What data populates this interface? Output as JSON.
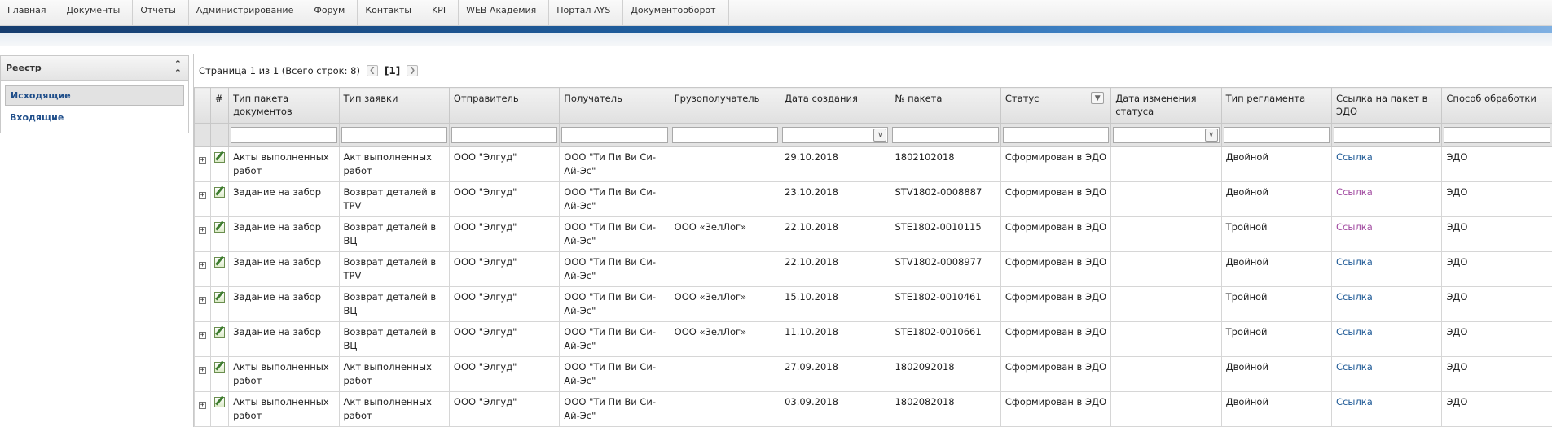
{
  "nav": [
    "Главная",
    "Документы",
    "Отчеты",
    "Администрирование",
    "Форум",
    "Контакты",
    "KPI",
    "WEB Академия",
    "Портал AYS",
    "Документооборот"
  ],
  "sidebar": {
    "title": "Реестр",
    "items": [
      {
        "label": "Исходящие",
        "active": true
      },
      {
        "label": "Входящие",
        "active": false
      }
    ]
  },
  "pager": {
    "text": "Страница 1 из 1 (Всего строк: 8)",
    "current": "[1]",
    "prev_icon": "chevron-left-icon",
    "next_icon": "chevron-right-icon"
  },
  "columns": [
    "#",
    "Тип пакета документов",
    "Тип заявки",
    "Отправитель",
    "Получатель",
    "Грузополучатель",
    "Дата создания",
    "№ пакета",
    "Статус",
    "Дата изменения статуса",
    "Тип регламента",
    "Ссылка на пакет в ЭДО",
    "Способ обработки"
  ],
  "rows": [
    {
      "type": "Акты выполненных работ",
      "request": "Акт выполненных работ",
      "sender": "ООО \"Элгуд\"",
      "recipient": "ООО \"Ти Пи Ви Си-Ай-Эс\"",
      "consignee": "",
      "created": "29.10.2018",
      "num": "1802102018",
      "status": "Сформирован в ЭДО",
      "changed": "",
      "regl": "Двойной",
      "link": "Ссылка",
      "method": "ЭДО"
    },
    {
      "type": "Задание на забор",
      "request": "Возврат деталей в TPV",
      "sender": "ООО \"Элгуд\"",
      "recipient": "ООО \"Ти Пи Ви Си-Ай-Эс\"",
      "consignee": "",
      "created": "23.10.2018",
      "num": "STV1802-0008887",
      "status": "Сформирован в ЭДО",
      "changed": "",
      "regl": "Двойной",
      "link": "Ссылка",
      "method": "ЭДО"
    },
    {
      "type": "Задание на забор",
      "request": "Возврат деталей в ВЦ",
      "sender": "ООО \"Элгуд\"",
      "recipient": "ООО \"Ти Пи Ви Си-Ай-Эс\"",
      "consignee": "ООО «ЗелЛог»",
      "created": "22.10.2018",
      "num": "STE1802-0010115",
      "status": "Сформирован в ЭДО",
      "changed": "",
      "regl": "Тройной",
      "link": "Ссылка",
      "method": "ЭДО"
    },
    {
      "type": "Задание на забор",
      "request": "Возврат деталей в TPV",
      "sender": "ООО \"Элгуд\"",
      "recipient": "ООО \"Ти Пи Ви Си-Ай-Эс\"",
      "consignee": "",
      "created": "22.10.2018",
      "num": "STV1802-0008977",
      "status": "Сформирован в ЭДО",
      "changed": "",
      "regl": "Двойной",
      "link": "Ссылка",
      "method": "ЭДО"
    },
    {
      "type": "Задание на забор",
      "request": "Возврат деталей в ВЦ",
      "sender": "ООО \"Элгуд\"",
      "recipient": "ООО \"Ти Пи Ви Си-Ай-Эс\"",
      "consignee": "ООО «ЗелЛог»",
      "created": "15.10.2018",
      "num": "STE1802-0010461",
      "status": "Сформирован в ЭДО",
      "changed": "",
      "regl": "Тройной",
      "link": "Ссылка",
      "method": "ЭДО"
    },
    {
      "type": "Задание на забор",
      "request": "Возврат деталей в ВЦ",
      "sender": "ООО \"Элгуд\"",
      "recipient": "ООО \"Ти Пи Ви Си-Ай-Эс\"",
      "consignee": "ООО «ЗелЛог»",
      "created": "11.10.2018",
      "num": "STE1802-0010661",
      "status": "Сформирован в ЭДО",
      "changed": "",
      "regl": "Тройной",
      "link": "Ссылка",
      "method": "ЭДО"
    },
    {
      "type": "Акты выполненных работ",
      "request": "Акт выполненных работ",
      "sender": "ООО \"Элгуд\"",
      "recipient": "ООО \"Ти Пи Ви Си-Ай-Эс\"",
      "consignee": "",
      "created": "27.09.2018",
      "num": "1802092018",
      "status": "Сформирован в ЭДО",
      "changed": "",
      "regl": "Двойной",
      "link": "Ссылка",
      "method": "ЭДО"
    },
    {
      "type": "Акты выполненных работ",
      "request": "Акт выполненных работ",
      "sender": "ООО \"Элгуд\"",
      "recipient": "ООО \"Ти Пи Ви Си-Ай-Эс\"",
      "consignee": "",
      "created": "03.09.2018",
      "num": "1802082018",
      "status": "Сформирован в ЭДО",
      "changed": "",
      "regl": "Двойной",
      "link": "Ссылка",
      "method": "ЭДО"
    }
  ],
  "colors": {
    "link": "#1f5a96",
    "link_visited": "#a14aa0",
    "brand_bar": "#1f5fa0",
    "sidebar_active_text": "#1f4e8a"
  }
}
